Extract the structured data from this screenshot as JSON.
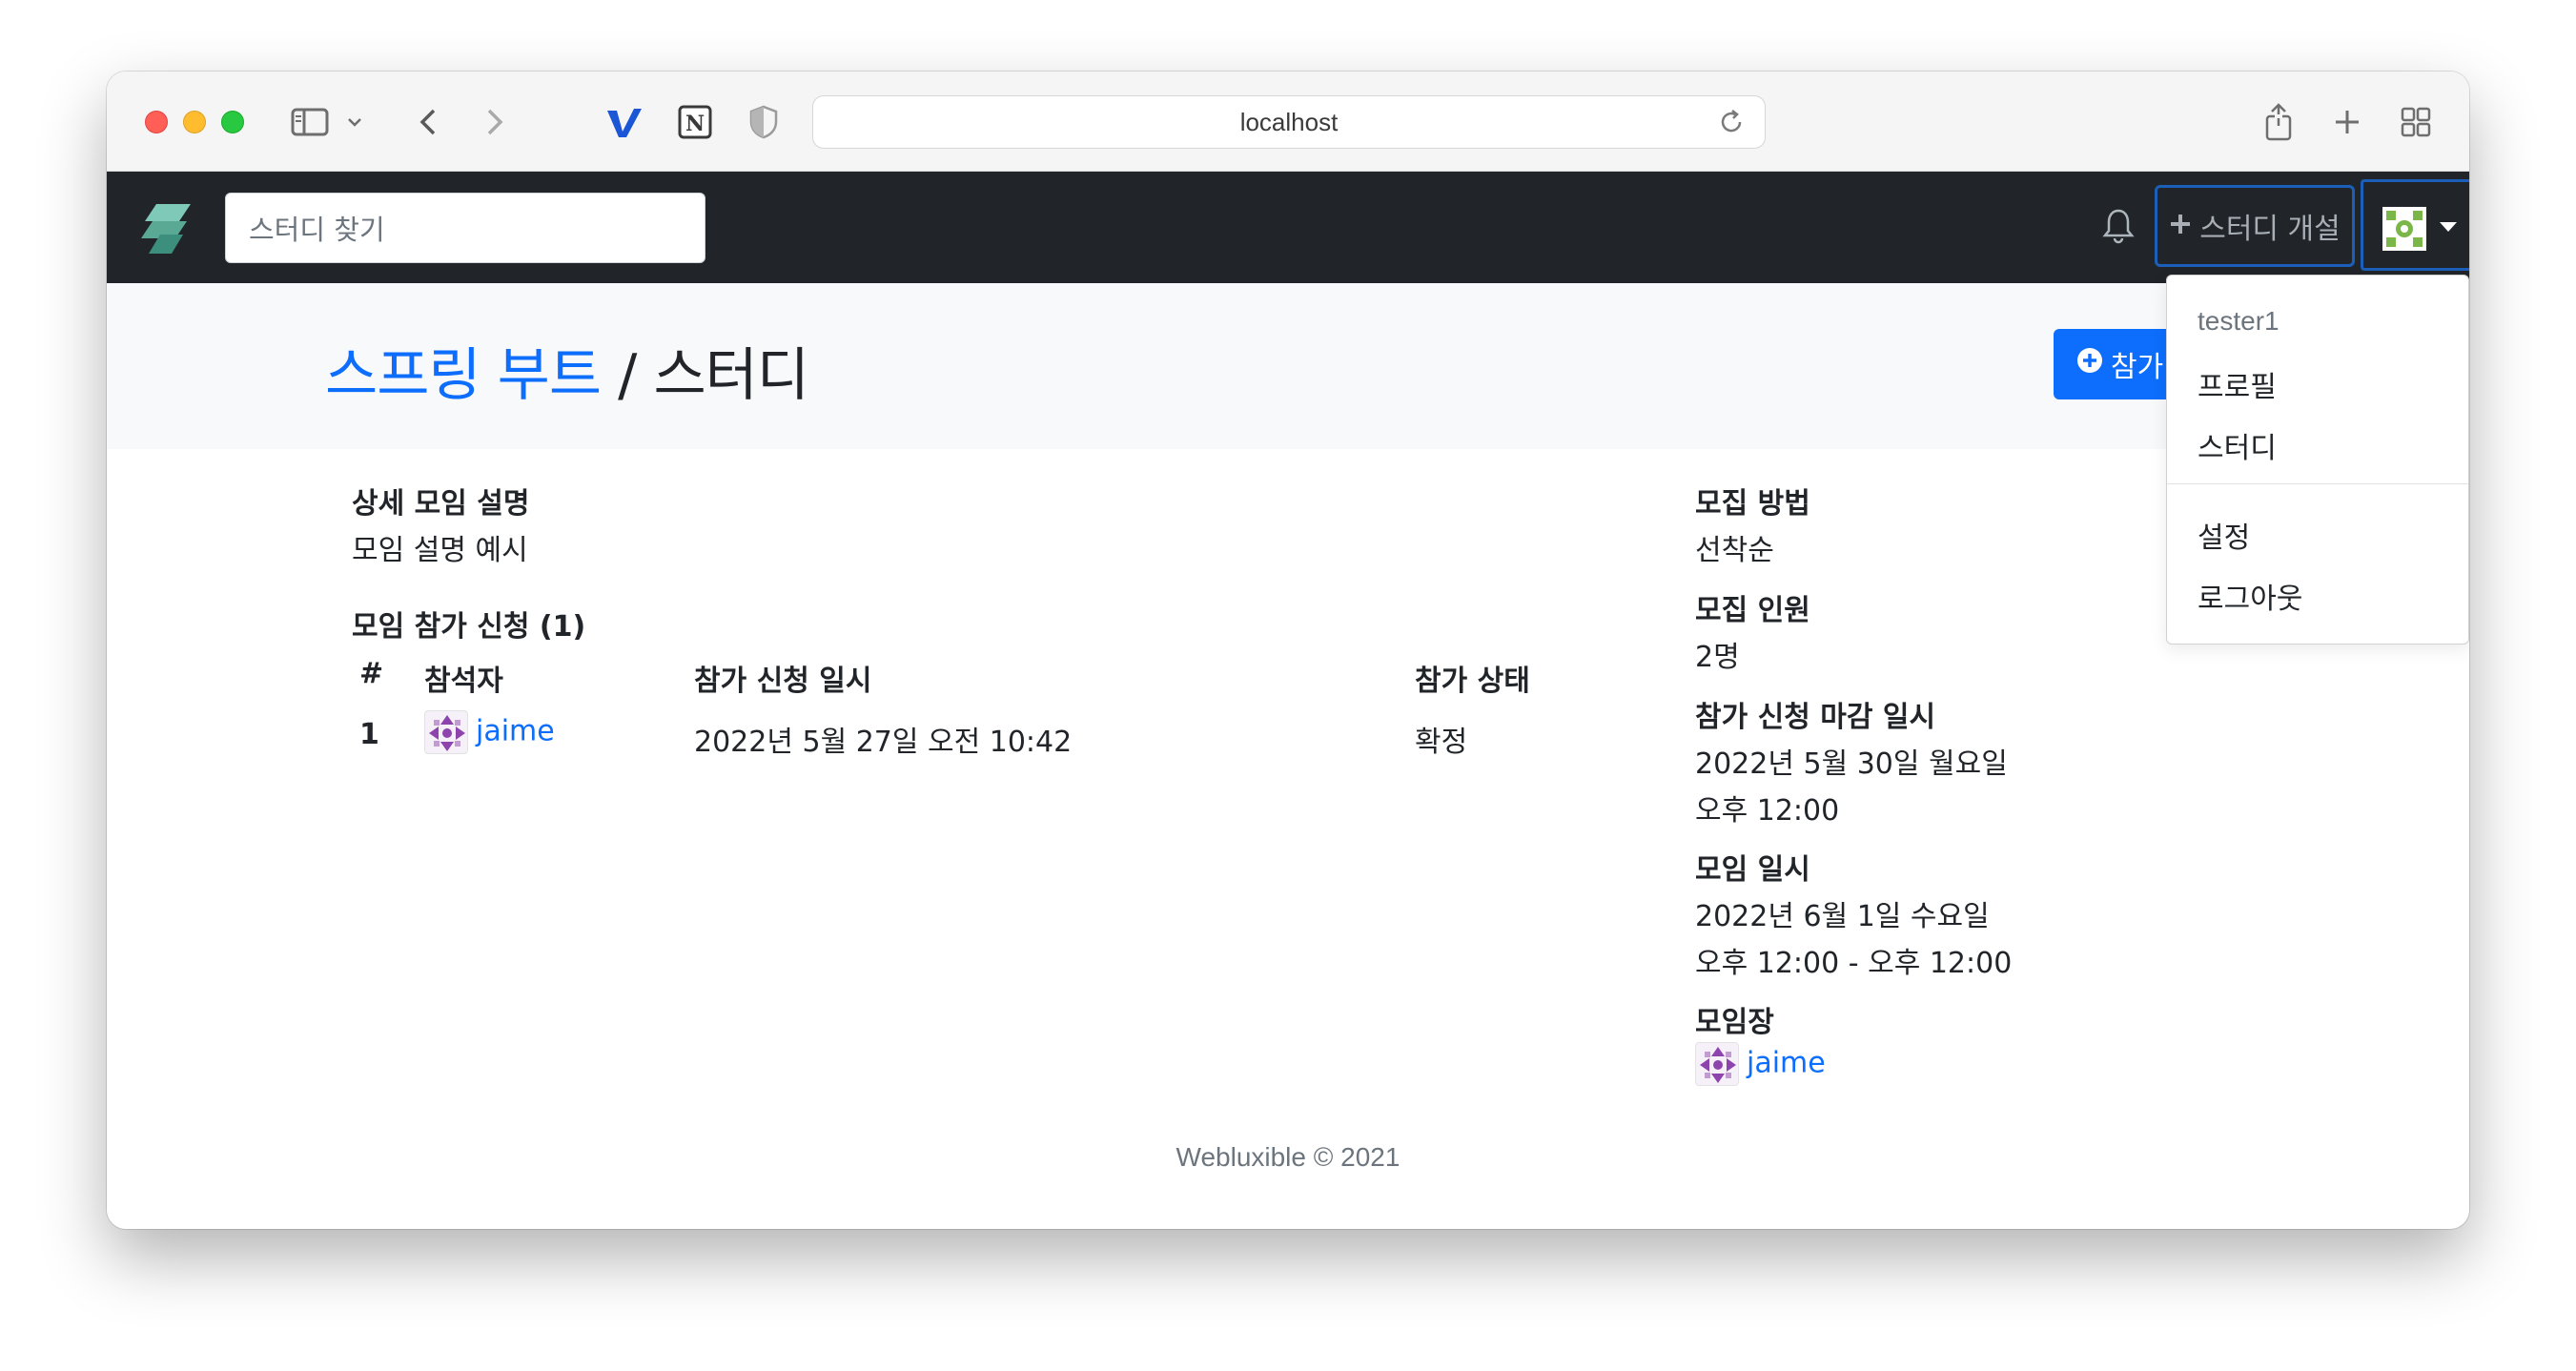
{
  "browser": {
    "url": "localhost"
  },
  "navbar": {
    "search_placeholder": "스터디 찾기",
    "create_study_label": "스터디 개설"
  },
  "header": {
    "study_link": "스프링 부트",
    "separator": " / ",
    "section": "스터디",
    "join_button_label": "참가"
  },
  "detail": {
    "description_label": "상세 모임 설명",
    "description_value": "모임 설명 예시",
    "applications_label": "모임 참가 신청 (1)"
  },
  "table": {
    "headers": [
      "#",
      "참석자",
      "참가 신청 일시",
      "참가 상태"
    ],
    "rows": [
      {
        "num": "1",
        "attendee": "jaime",
        "applied_at": "2022년 5월 27일 오전 10:42",
        "status": "확정"
      }
    ]
  },
  "sidebar": {
    "method_label": "모집 방법",
    "method_value": "선착순",
    "capacity_label": "모집 인원",
    "capacity_value": "2명",
    "deadline_label": "참가 신청 마감 일시",
    "deadline_date": "2022년 5월 30일 월요일",
    "deadline_time": "오후 12:00",
    "event_label": "모임 일시",
    "event_date": "2022년 6월 1일 수요일",
    "event_time": "오후 12:00 - 오후 12:00",
    "manager_label": "모임장",
    "manager_name": "jaime"
  },
  "dropdown": {
    "username": "tester1",
    "items": [
      "프로필",
      "스터디",
      "설정",
      "로그아웃"
    ]
  },
  "footer": {
    "text": "Webluxible © 2021"
  },
  "colors": {
    "navbar_bg": "#212529",
    "primary": "#0d6efd",
    "header_bg": "#f8f9fa"
  }
}
